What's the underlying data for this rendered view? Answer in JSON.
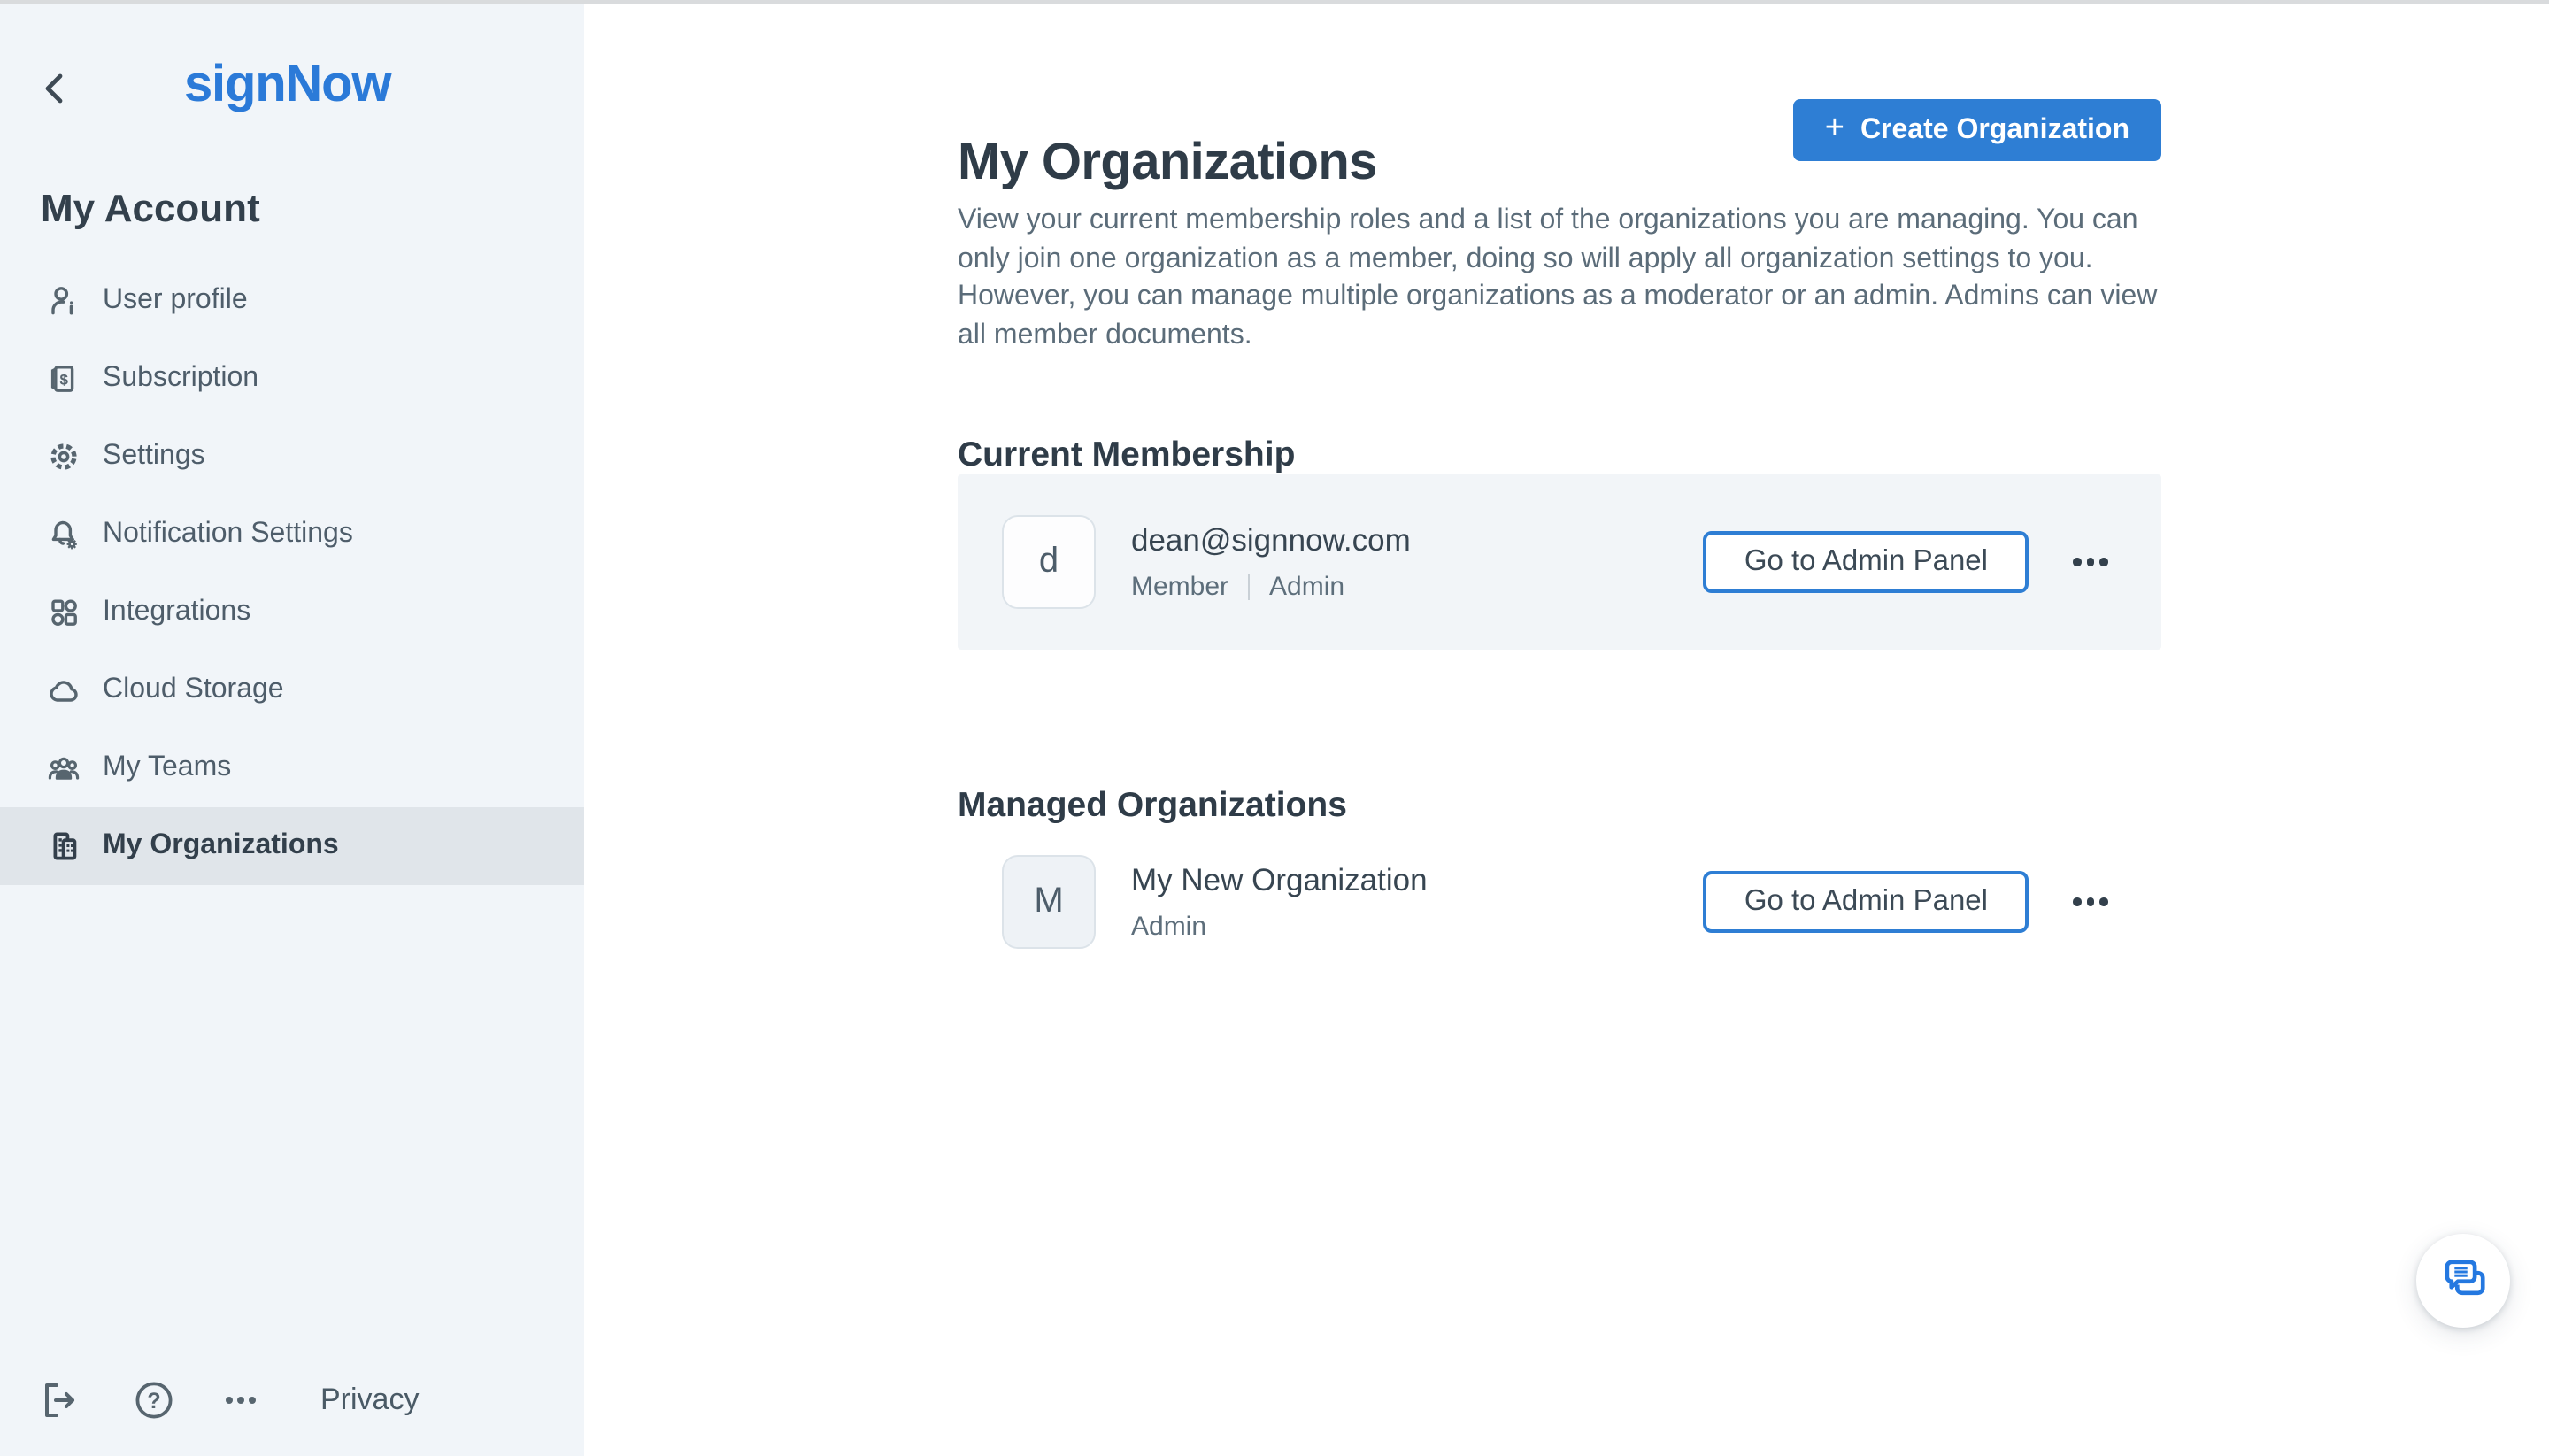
{
  "sidebar": {
    "logo": "signNow",
    "section_title": "My Account",
    "items": [
      {
        "label": "User profile",
        "icon": "user-profile-icon",
        "active": false
      },
      {
        "label": "Subscription",
        "icon": "subscription-icon",
        "active": false
      },
      {
        "label": "Settings",
        "icon": "gear-icon",
        "active": false
      },
      {
        "label": "Notification Settings",
        "icon": "bell-gear-icon",
        "active": false
      },
      {
        "label": "Integrations",
        "icon": "integrations-icon",
        "active": false
      },
      {
        "label": "Cloud Storage",
        "icon": "cloud-icon",
        "active": false
      },
      {
        "label": "My Teams",
        "icon": "people-icon",
        "active": false
      },
      {
        "label": "My Organizations",
        "icon": "buildings-icon",
        "active": true
      }
    ],
    "footer": {
      "privacy_label": "Privacy"
    }
  },
  "main": {
    "title": "My Organizations",
    "create_button": {
      "label": "Create Organization",
      "plus": "+"
    },
    "description": "View your current membership roles and a list of the organizations you are managing. You can only join one organization as a member, doing so will apply all organization settings to you. However, you can manage multiple organizations as a moderator or an admin. Admins can view all member documents.",
    "sections": [
      {
        "heading": "Current Membership",
        "rows": [
          {
            "avatar_letter": "d",
            "title": "dean@signnow.com",
            "roles": [
              "Member",
              "Admin"
            ],
            "action_label": "Go to Admin Panel"
          }
        ]
      },
      {
        "heading": "Managed Organizations",
        "rows": [
          {
            "avatar_letter": "M",
            "title": "My New Organization",
            "roles": [
              "Admin"
            ],
            "action_label": "Go to Admin Panel"
          }
        ]
      }
    ]
  },
  "colors": {
    "brand_blue": "#2b7ad8",
    "button_blue": "#2e7ed4",
    "sidebar_bg": "#f1f5f9",
    "sidebar_active_bg": "#e0e5ea",
    "card_bg": "#f2f5f8",
    "heading_text": "#2f3c48",
    "body_text": "#5b6c79"
  }
}
